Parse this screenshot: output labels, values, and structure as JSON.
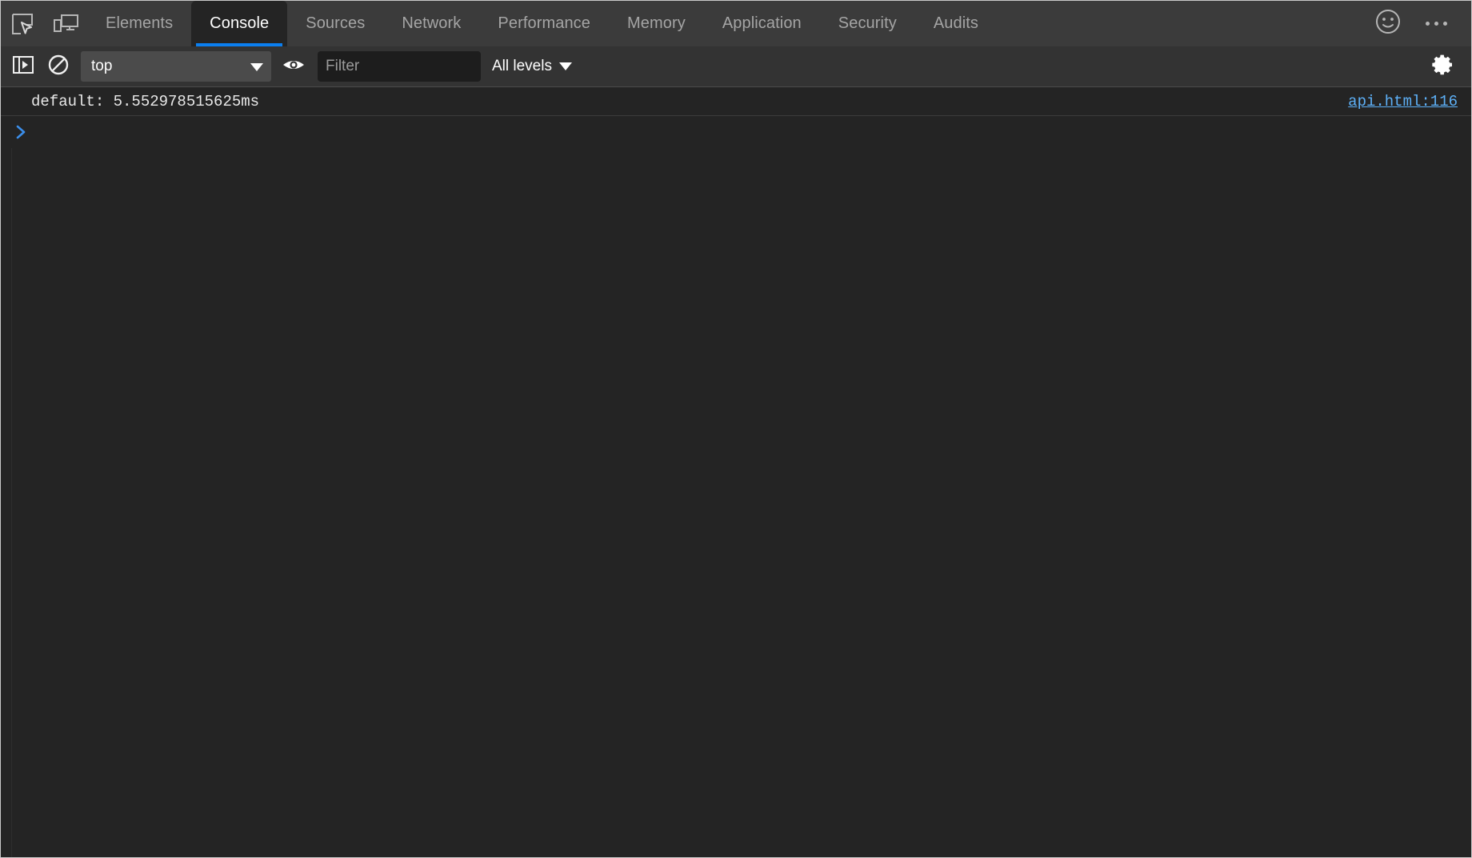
{
  "window": {
    "app": "Chrome DevTools",
    "panel": "Console"
  },
  "tabbar": {
    "inspect_icon": "inspect-element-icon",
    "device_icon": "device-toolbar-icon",
    "tabs": [
      {
        "label": "Elements",
        "active": false
      },
      {
        "label": "Console",
        "active": true
      },
      {
        "label": "Sources",
        "active": false
      },
      {
        "label": "Network",
        "active": false
      },
      {
        "label": "Performance",
        "active": false
      },
      {
        "label": "Memory",
        "active": false
      },
      {
        "label": "Application",
        "active": false
      },
      {
        "label": "Security",
        "active": false
      },
      {
        "label": "Audits",
        "active": false
      }
    ],
    "feedback_icon": "smiley-face-icon",
    "more_icon": "more-options-icon",
    "active_tab_underline_color": "#0b7ff0"
  },
  "toolbar": {
    "sidebar_toggle_icon": "console-sidebar-toggle-icon",
    "clear_icon": "clear-console-icon",
    "context": {
      "value": "top",
      "caret_icon": "chevron-down-icon"
    },
    "live_expression_icon": "eye-icon",
    "filter": {
      "value": "",
      "placeholder": "Filter"
    },
    "levels": {
      "label": "All levels",
      "caret_icon": "chevron-down-icon"
    },
    "settings_icon": "gear-icon"
  },
  "console": {
    "messages": [
      {
        "text": "default: 5.552978515625ms",
        "source": "api.html:116",
        "source_color": "#5db0f7"
      }
    ],
    "prompt": {
      "chevron_icon": "prompt-chevron-icon",
      "value": ""
    }
  }
}
